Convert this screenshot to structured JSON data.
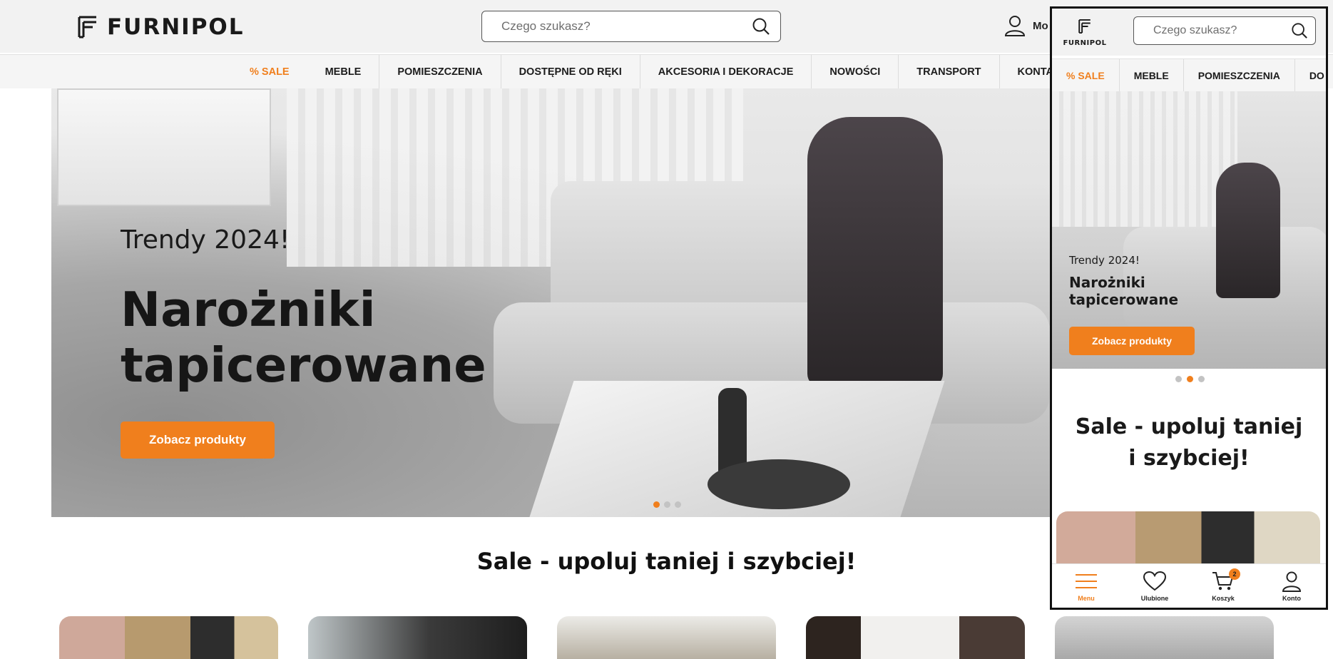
{
  "brand": {
    "name": "FURNIPOL"
  },
  "search": {
    "placeholder": "Czego szukasz?"
  },
  "account": {
    "label": "Mo"
  },
  "nav": {
    "items": [
      "% SALE",
      "MEBLE",
      "POMIESZCZENIA",
      "DOSTĘPNE OD RĘKI",
      "AKCESORIA I DEKORACJE",
      "NOWOŚCI",
      "TRANSPORT",
      "KONTAKT"
    ]
  },
  "hero": {
    "kicker": "Trendy 2024!",
    "title_line1": "Narożniki",
    "title_line2": "tapicerowane",
    "cta": "Zobacz produkty",
    "slides": 3,
    "active_slide": 1
  },
  "sale_section": {
    "heading": "Sale - upoluj taniej i szybciej!"
  },
  "mobile": {
    "brand": "FURNIPOL",
    "search_placeholder": "Czego szukasz?",
    "nav": [
      "% SALE",
      "MEBLE",
      "POMIESZCZENIA",
      "DO"
    ],
    "hero": {
      "kicker": "Trendy 2024!",
      "title_line1": "Narożniki",
      "title_line2": "tapicerowane",
      "cta": "Zobacz produkty",
      "active_slide": 2
    },
    "sale_heading": "Sale - upoluj taniej i szybciej!",
    "bottom_nav": {
      "menu": "Menu",
      "favorites": "Ulubione",
      "cart": "Koszyk",
      "cart_count": "2",
      "account": "Konto"
    }
  },
  "colors": {
    "accent": "#f07f1d",
    "topbar": "#f2f2f2",
    "text": "#1a1a1a"
  },
  "icons": [
    "logo-mark-icon",
    "search-icon",
    "user-icon",
    "menu-icon",
    "heart-icon",
    "cart-icon"
  ]
}
